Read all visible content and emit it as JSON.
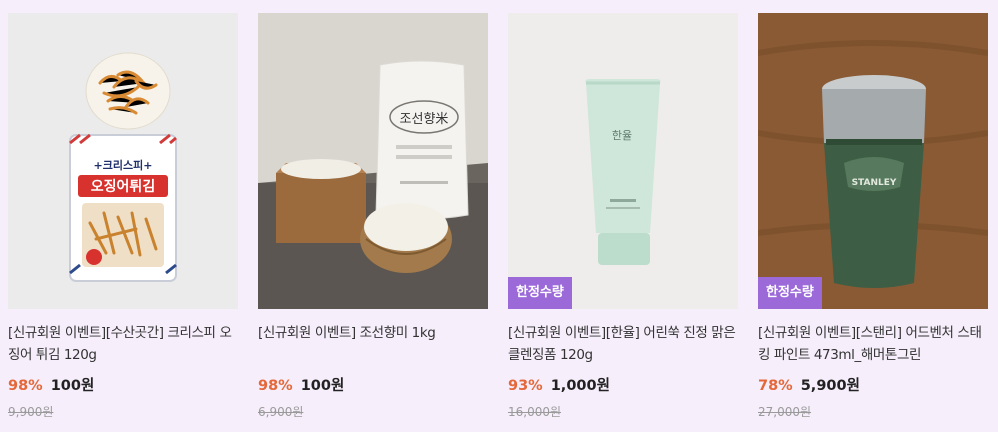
{
  "products": [
    {
      "image": "squid-snack-product-image",
      "title": "[신규회원 이벤트][수산곳간] 크리스피 오징어 튀김 120g",
      "discount": "98%",
      "price": "100원",
      "original": "9,900원",
      "package_text_top": "+크리스피+",
      "package_text_main": "오징어튀김"
    },
    {
      "image": "rice-product-image",
      "title": "[신규회원 이벤트] 조선향미 1kg",
      "discount": "98%",
      "price": "100원",
      "original": "6,900원",
      "package_text": "조선향米"
    },
    {
      "image": "cleansing-foam-product-image",
      "title": "[신규회원 이벤트][한율] 어린쑥 진정 맑은 클렌징폼 120g",
      "discount": "93%",
      "price": "1,000원",
      "original": "16,000원",
      "badge": "한정수량",
      "tube_brand": "한율"
    },
    {
      "image": "tumbler-product-image",
      "title": "[신규회원 이벤트][스탠리] 어드벤처 스태킹 파인트 473ml_해머톤그린",
      "discount": "78%",
      "price": "5,900원",
      "original": "27,000원",
      "badge": "한정수량",
      "cup_brand": "STANLEY"
    }
  ],
  "colors": {
    "background": "#f6eefb",
    "discount": "#e4683a",
    "badge": "#9b6ad8"
  }
}
